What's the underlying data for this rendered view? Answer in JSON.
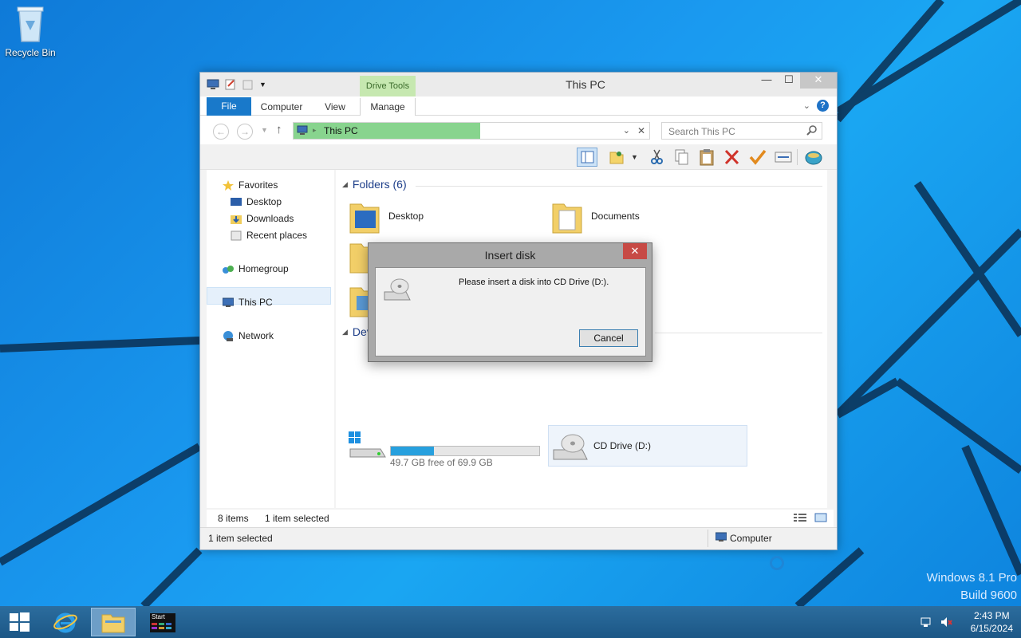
{
  "desktop": {
    "recycle_bin_label": "Recycle Bin",
    "watermark_line1": "Windows 8.1 Pro",
    "watermark_line2": "Build 9600"
  },
  "window": {
    "title": "This PC",
    "context_tab_group": "Drive Tools",
    "tabs": [
      {
        "label": "File"
      },
      {
        "label": "Computer"
      },
      {
        "label": "View"
      },
      {
        "label": "Manage"
      }
    ],
    "help_glyph": "?"
  },
  "navigation": {
    "address_text": "This PC",
    "search_placeholder": "Search This PC"
  },
  "nav_pane": {
    "favorites": "Favorites",
    "desktop": "Desktop",
    "downloads": "Downloads",
    "recent_places": "Recent places",
    "homegroup": "Homegroup",
    "this_pc": "This PC",
    "network": "Network"
  },
  "content": {
    "folders_header": "Folders (6)",
    "folders": [
      {
        "name": "Desktop"
      },
      {
        "name": "Documents"
      }
    ],
    "devices_header_visible": "Dev",
    "local_disk": {
      "free_text": "49.7 GB free of 69.9 GB",
      "used_fraction": 0.29
    },
    "cd_drive_label": "CD Drive (D:)"
  },
  "status": {
    "item_count": "8 items",
    "selected": "1 item selected",
    "bottom_left": "1 item selected",
    "bottom_right": "Computer"
  },
  "dialog": {
    "title": "Insert disk",
    "message": "Please insert a disk into CD Drive (D:).",
    "cancel_label": "Cancel",
    "close_glyph": "✕"
  },
  "taskbar": {
    "start_tile_label": "Start",
    "clock_time": "2:43 PM",
    "clock_date": "6/15/2024"
  },
  "colors": {
    "accent": "#1979ca",
    "address_progress": "#88d48e",
    "drive_tools": "#c6e8b0",
    "dialog_close": "#c74a45"
  }
}
